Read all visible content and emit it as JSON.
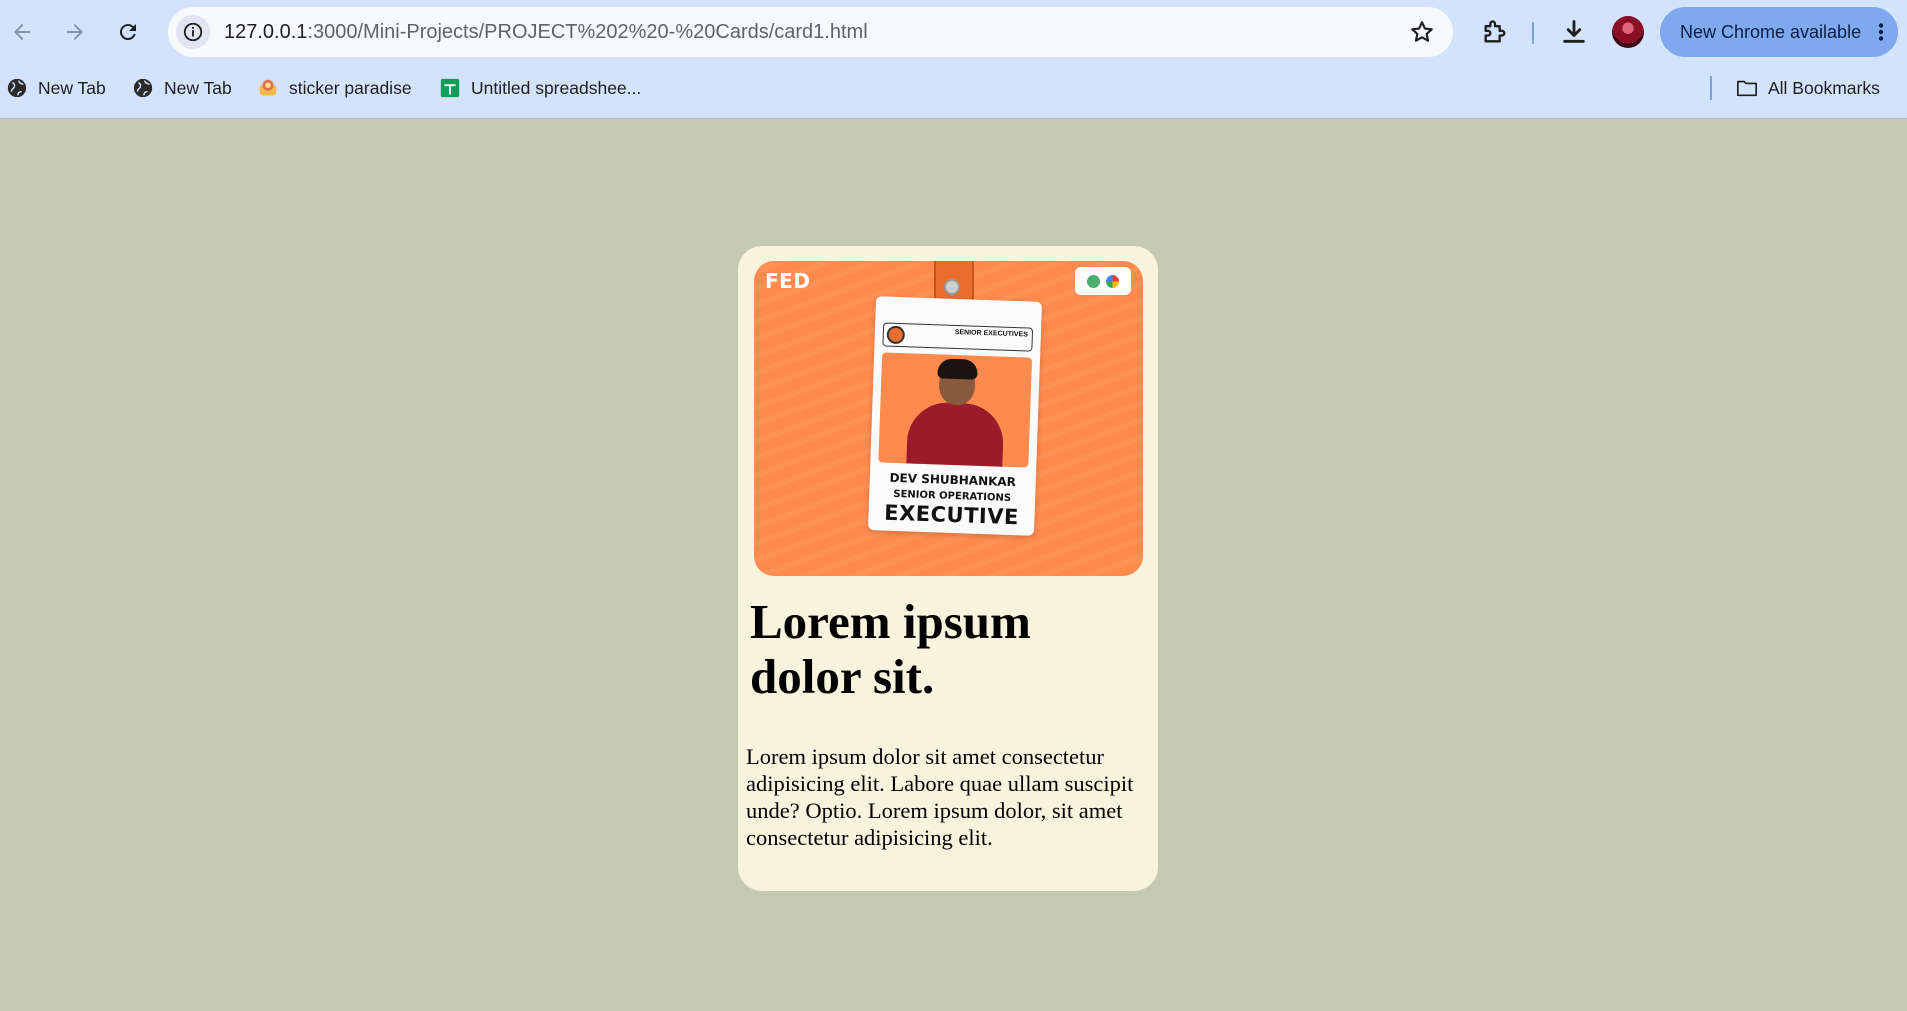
{
  "browser": {
    "url_host": "127.0.0.1",
    "url_path": ":3000/Mini-Projects/PROJECT%202%20-%20Cards/card1.html",
    "update_label": "New Chrome available",
    "bookmarks": [
      {
        "label": "New Tab",
        "icon": "globe-icon"
      },
      {
        "label": "New Tab",
        "icon": "globe-icon"
      },
      {
        "label": "sticker paradise",
        "icon": "sticker-icon"
      },
      {
        "label": "Untitled spreadshee...",
        "icon": "sheets-icon"
      }
    ],
    "all_bookmarks_label": "All Bookmarks"
  },
  "card": {
    "image": {
      "org_label": "FED",
      "id_role_small": "SENIOR EXECUTIVES",
      "id_name": "DEV SHUBHANKAR",
      "id_title_line1": "SENIOR OPERATIONS",
      "id_title_line2": "EXECUTIVE"
    },
    "title": "Lorem ipsum dolor sit.",
    "text": "Lorem ipsum dolor sit amet consectetur adipisicing elit. Labore quae ullam suscipit unde? Optio. Lorem ipsum dolor, sit amet consectetur adipisicing elit."
  },
  "colors": {
    "page_background": "#c7cab3",
    "card_background": "#f6f4dc",
    "image_background": "#ff8a4d",
    "chrome_background": "#d3e3fd",
    "update_button": "#7fa9ee"
  }
}
